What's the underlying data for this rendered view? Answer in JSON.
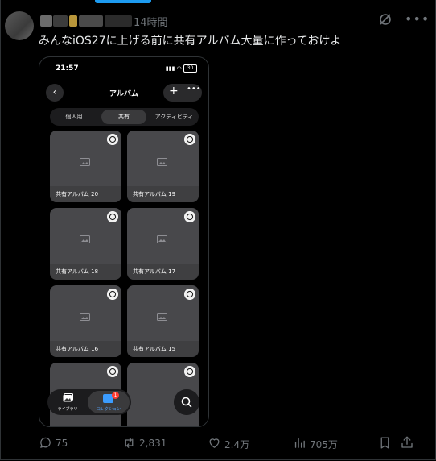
{
  "post": {
    "timestamp": "14時間",
    "text": "みんなiOS27に上げる前に共有アルバム大量に作っておけよ",
    "stats": {
      "replies": "75",
      "reposts": "2,831",
      "likes": "2.4万",
      "views": "705万"
    }
  },
  "phone": {
    "status_time": "21:57",
    "battery": "30",
    "title": "アルバム",
    "segments": [
      "個人用",
      "共有",
      "アクティビティ"
    ],
    "selected_segment": "共有",
    "albums": [
      "共有アルバム 20",
      "共有アルバム 19",
      "共有アルバム 18",
      "共有アルバム 17",
      "共有アルバム 16",
      "共有アルバム 15",
      "",
      ""
    ],
    "tabs": [
      {
        "label": "ライブラリ",
        "icon": "photo-library-icon"
      },
      {
        "label": "コレクション",
        "icon": "collections-icon",
        "badge": "1"
      }
    ]
  },
  "colors": {
    "accent": "#1d9bf0",
    "muted": "#71767b",
    "card": "#48484b",
    "badge": "#ff3b30"
  }
}
